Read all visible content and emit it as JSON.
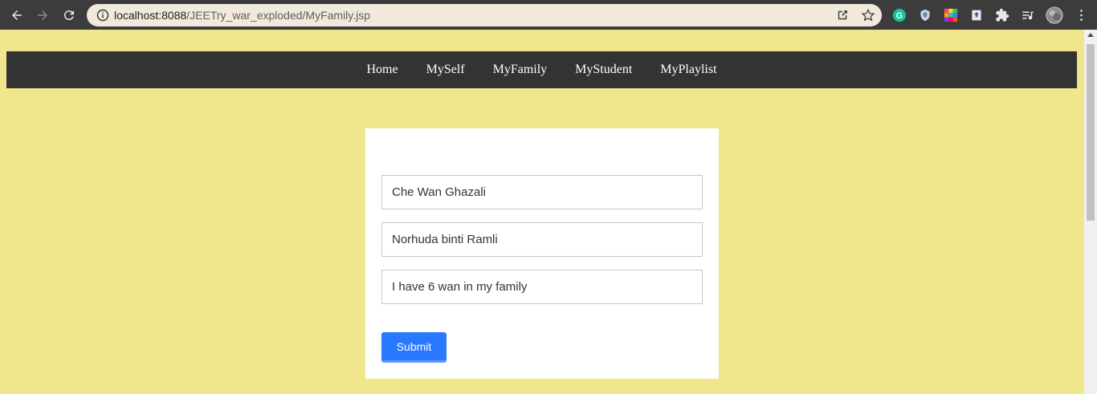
{
  "browser": {
    "url_host": "localhost:8088",
    "url_path": "/JEETry_war_exploded/MyFamily.jsp"
  },
  "nav": {
    "items": [
      {
        "label": "Home"
      },
      {
        "label": "MySelf"
      },
      {
        "label": "MyFamily"
      },
      {
        "label": "MyStudent"
      },
      {
        "label": "MyPlaylist"
      }
    ]
  },
  "form": {
    "father_value": "Che Wan Ghazali",
    "mother_value": "Norhuda binti Ramli",
    "about_value": "I have 6 wan in my family",
    "submit_label": "Submit"
  },
  "colors": {
    "page_background": "#f0e68c",
    "navbar_background": "#333333",
    "submit_button": "#2979ff"
  },
  "icons": [
    "back-icon",
    "forward-icon",
    "reload-icon",
    "site-info-icon",
    "share-icon",
    "bookmark-star-icon",
    "grammarly-icon",
    "shield-extension-icon",
    "color-extension-icon",
    "upload-extension-icon",
    "puzzle-extensions-icon",
    "reading-list-icon",
    "profile-avatar",
    "kebab-menu-icon"
  ]
}
